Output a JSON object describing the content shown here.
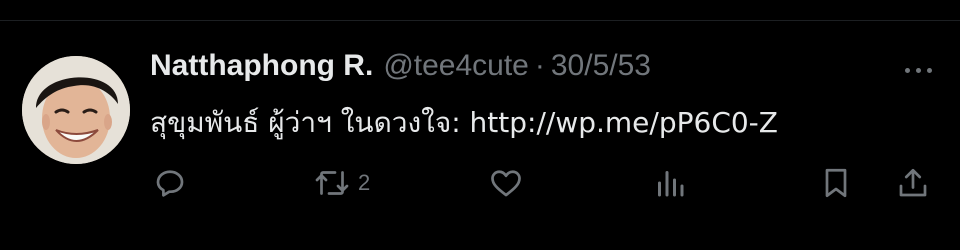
{
  "colors": {
    "background": "#000000",
    "primary_text": "#e7e9ea",
    "secondary_text": "#71767b"
  },
  "tweet": {
    "author": {
      "display_name": "Natthaphong R.",
      "handle": "@tee4cute"
    },
    "separator": "·",
    "date": "30/5/53",
    "text": "สุขุมพันธ์ ผู้ว่าฯ ในดวงใจ: http://wp.me/pP6C0-Z",
    "actions": {
      "reply": {
        "icon": "reply-icon",
        "count": ""
      },
      "retweet": {
        "icon": "retweet-icon",
        "count": "2"
      },
      "like": {
        "icon": "heart-icon",
        "count": ""
      },
      "views": {
        "icon": "views-icon",
        "count": ""
      },
      "bookmark": {
        "icon": "bookmark-icon"
      },
      "share": {
        "icon": "share-icon"
      }
    }
  }
}
